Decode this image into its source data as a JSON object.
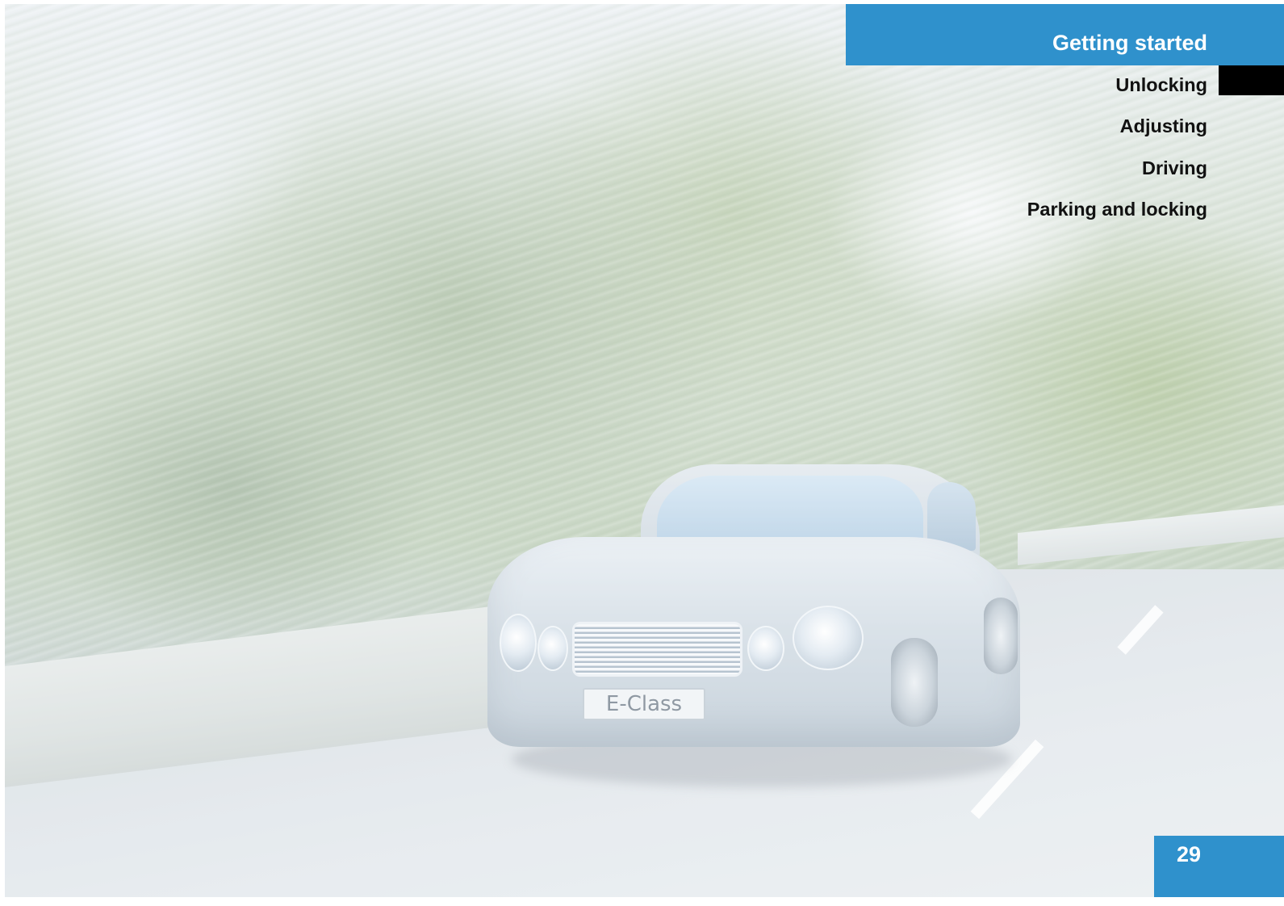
{
  "header": {
    "section_title": "Getting started"
  },
  "nav": {
    "items": [
      {
        "label": "Unlocking",
        "active": true
      },
      {
        "label": "Adjusting",
        "active": false
      },
      {
        "label": "Driving",
        "active": false
      },
      {
        "label": "Parking and locking",
        "active": false
      }
    ]
  },
  "photo": {
    "plate_text": "E-Class"
  },
  "footer": {
    "page_number": "29"
  },
  "colors": {
    "accent": "#2f91cc",
    "active_marker": "#000000",
    "nav_text": "#111111"
  }
}
